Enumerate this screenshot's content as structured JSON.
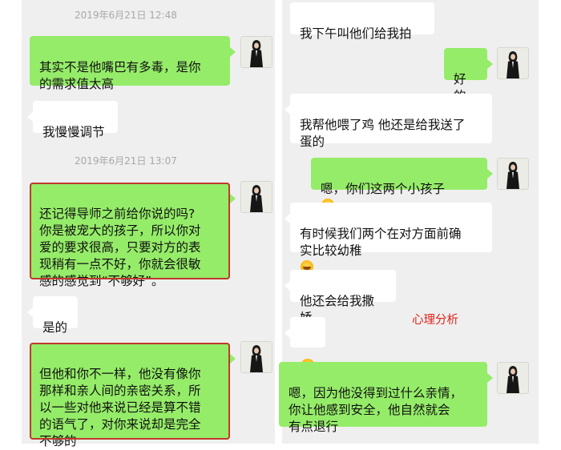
{
  "left": {
    "timestamps": [
      "2019年6月21日 12:48",
      "2019年6月21日 13:07"
    ],
    "messages": [
      "其实不是他嘴巴有多毒，是你\n的需求值太高",
      "我慢慢调节",
      "还记得导师之前给你说的吗?\n你是被宠大的孩子，所以你对\n爱的要求很高，只要对方的表\n现稍有一点不好，你就会很敏\n感的感觉到“不够好”。",
      "是的",
      "但他和你不一样，他没有像你\n那样和亲人间的亲密关系，所\n以一些对他来说已经是算不错\n的语气了，对你来说却是完全\n不够的"
    ]
  },
  "right": {
    "messages": [
      "我下午叫他们给我拍",
      "好的",
      "我帮他喂了鸡 他还是给我送了\n蛋的",
      "嗯，你们这两个小孩子",
      "有时候我们两个在对方面前确\n实比较幼稚",
      "他还会给我撒娇",
      "",
      "嗯，因为他没得到过什么亲情，\n你让他感到安全，他自然就会\n有点退行"
    ],
    "annotation": "心理分析"
  },
  "icons": {
    "avatar": "avatar-woman-in-black-icon",
    "emoji": "laughing-face-emoji-icon"
  },
  "colors": {
    "pane_background": "#efefef",
    "sent_bubble": "#95ec69",
    "received_bubble": "#ffffff",
    "highlight_box": "#c0392b",
    "annotation": "#e0231c",
    "timestamp": "#a8a8a8"
  }
}
